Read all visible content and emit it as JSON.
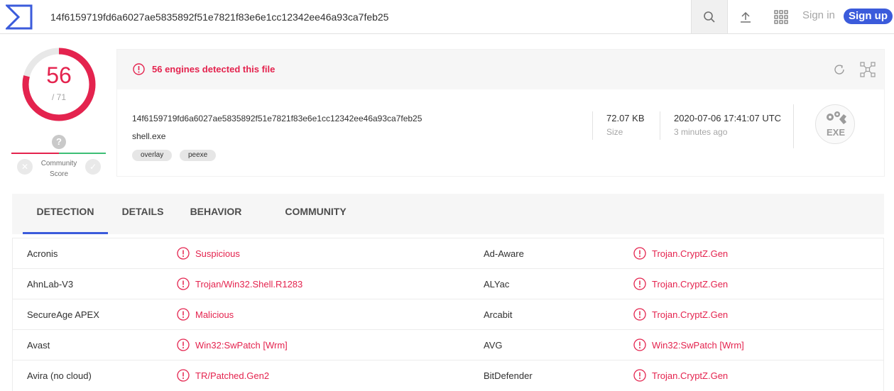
{
  "search": {
    "value": "14f6159719fd6a6027ae5835892f51e7821f83e6e1cc12342ee46a93ca7feb25"
  },
  "header": {
    "signin_label": "Sign in",
    "signup_label": "Sign up"
  },
  "score": {
    "detected": "56",
    "total": "/ 71",
    "fraction": 0.789
  },
  "community": {
    "question": "?",
    "label_line1": "Community",
    "label_line2": "Score"
  },
  "summary": {
    "alert": "56 engines detected this file",
    "hash": "14f6159719fd6a6027ae5835892f51e7821f83e6e1cc12342ee46a93ca7feb25",
    "filename": "shell.exe",
    "tags": [
      "overlay",
      "peexe"
    ],
    "size_value": "72.07 KB",
    "size_label": "Size",
    "date_value": "2020-07-06 17:41:07 UTC",
    "date_label": "3 minutes ago",
    "filetype": "EXE"
  },
  "tabs": [
    "DETECTION",
    "DETAILS",
    "BEHAVIOR",
    "COMMUNITY"
  ],
  "detections": [
    {
      "left_engine": "Acronis",
      "left_result": "Suspicious",
      "right_engine": "Ad-Aware",
      "right_result": "Trojan.CryptZ.Gen"
    },
    {
      "left_engine": "AhnLab-V3",
      "left_result": "Trojan/Win32.Shell.R1283",
      "right_engine": "ALYac",
      "right_result": "Trojan.CryptZ.Gen"
    },
    {
      "left_engine": "SecureAge APEX",
      "left_result": "Malicious",
      "right_engine": "Arcabit",
      "right_result": "Trojan.CryptZ.Gen"
    },
    {
      "left_engine": "Avast",
      "left_result": "Win32:SwPatch [Wrm]",
      "right_engine": "AVG",
      "right_result": "Win32:SwPatch [Wrm]"
    },
    {
      "left_engine": "Avira (no cloud)",
      "left_result": "TR/Patched.Gen2",
      "right_engine": "BitDefender",
      "right_result": "Trojan.CryptZ.Gen"
    }
  ],
  "colors": {
    "accent": "#3b5bdb",
    "danger": "#e4234e",
    "ok": "#3dbe76"
  }
}
